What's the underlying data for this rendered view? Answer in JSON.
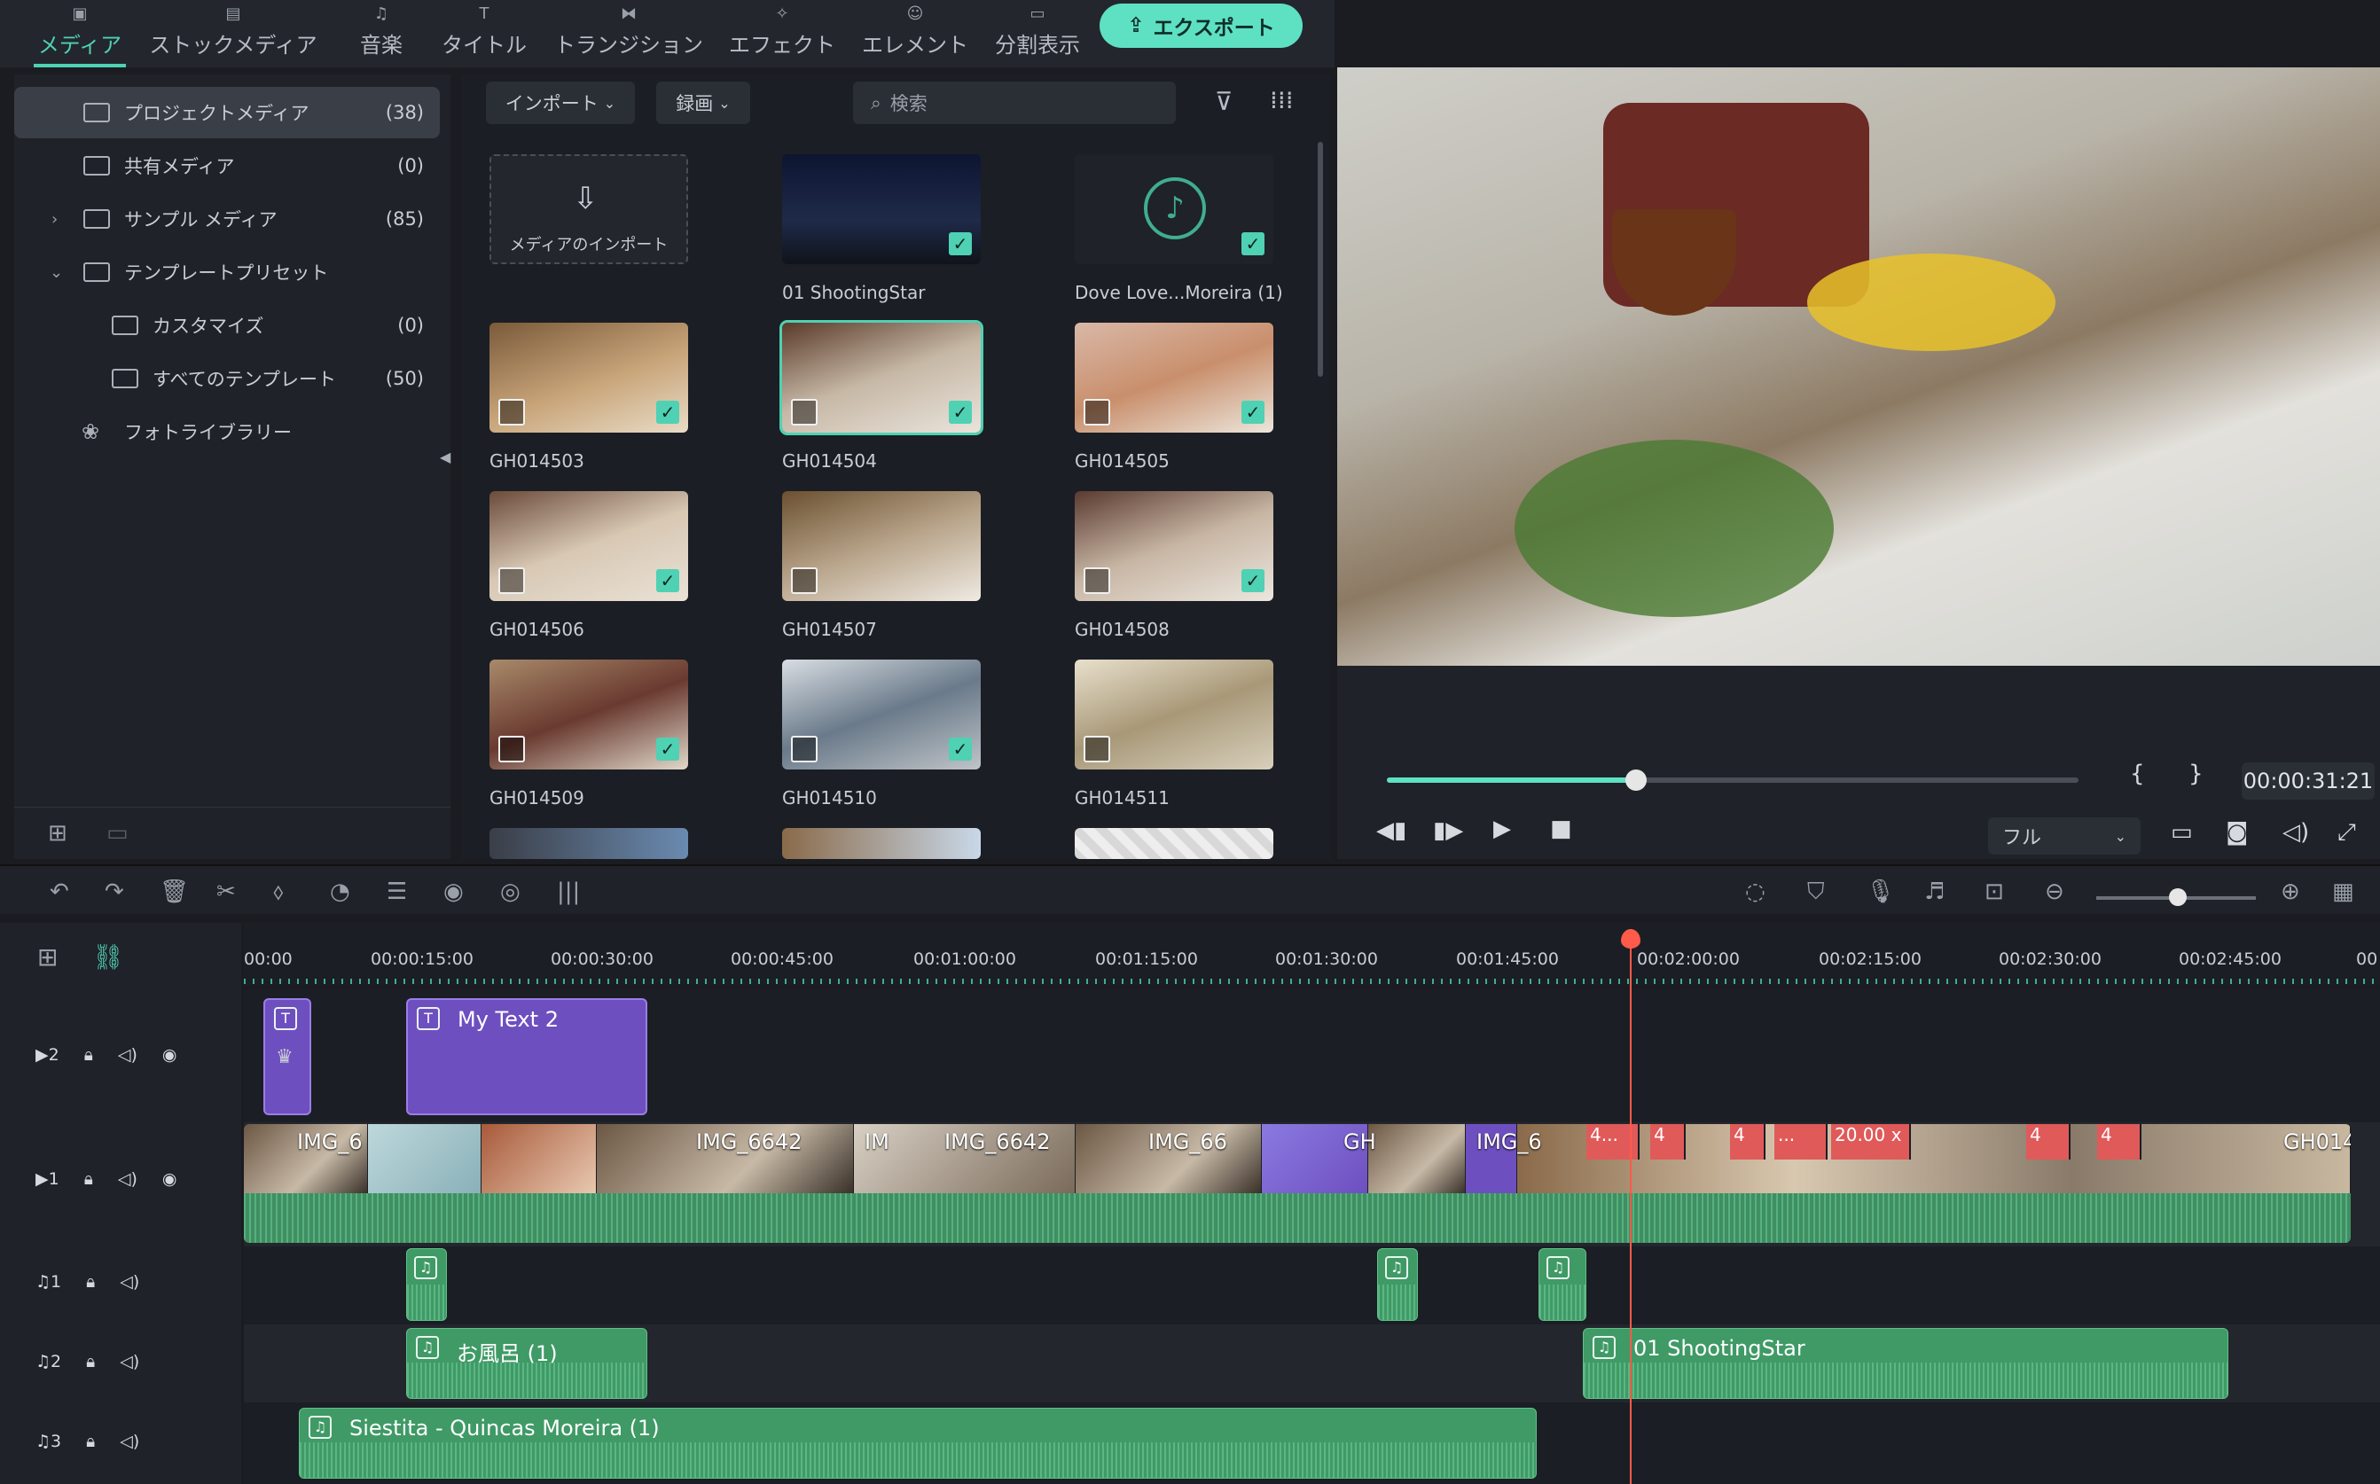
{
  "nav": {
    "tabs": [
      {
        "label": "メディア",
        "icon": "media-icon",
        "active": true
      },
      {
        "label": "ストックメディア",
        "icon": "stock-icon"
      },
      {
        "label": "音楽",
        "icon": "music-icon"
      },
      {
        "label": "タイトル",
        "icon": "title-icon"
      },
      {
        "label": "トランジション",
        "icon": "transition-icon"
      },
      {
        "label": "エフェクト",
        "icon": "effect-icon"
      },
      {
        "label": "エレメント",
        "icon": "element-icon"
      },
      {
        "label": "分割表示",
        "icon": "split-icon"
      }
    ],
    "export_label": "エクスポート"
  },
  "library": {
    "items": [
      {
        "label": "プロジェクトメディア",
        "count": "(38)"
      },
      {
        "label": "共有メディア",
        "count": "(0)"
      },
      {
        "label": "サンプル メディア",
        "count": "(85)"
      },
      {
        "label": "テンプレートプリセット",
        "count": ""
      },
      {
        "label": "カスタマイズ",
        "count": "(0)"
      },
      {
        "label": "すべてのテンプレート",
        "count": "(50)"
      },
      {
        "label": "フォトライブラリー",
        "count": ""
      }
    ]
  },
  "media": {
    "import_label": "インポート",
    "record_label": "録画",
    "search_placeholder": "検索",
    "import_tile_label": "メディアのインポート",
    "items": [
      {
        "name": "01 ShootingStar"
      },
      {
        "name": "Dove Love...Moreira (1)"
      },
      {
        "name": "GH014503"
      },
      {
        "name": "GH014504"
      },
      {
        "name": "GH014505"
      },
      {
        "name": "GH014506"
      },
      {
        "name": "GH014507"
      },
      {
        "name": "GH014508"
      },
      {
        "name": "GH014509"
      },
      {
        "name": "GH014510"
      },
      {
        "name": "GH014511"
      }
    ]
  },
  "player": {
    "timecode": "00:00:31:21",
    "quality": "フル",
    "progress": 0.36
  },
  "ruler": {
    "ticks": [
      "00:00",
      "00:00:15:00",
      "00:00:30:00",
      "00:00:45:00",
      "00:01:00:00",
      "00:01:15:00",
      "00:01:30:00",
      "00:01:45:00",
      "00:02:00:00",
      "00:02:15:00",
      "00:02:30:00",
      "00:02:45:00",
      "00"
    ]
  },
  "tracks": {
    "video2": {
      "num": "2",
      "title_clip": "My Text 2"
    },
    "video1": {
      "num": "1",
      "labels": [
        "IMG_6",
        "IMG_6642",
        "IM",
        "IMG_6642",
        "IMG_66",
        "GH",
        "IMG_6",
        "GH014"
      ],
      "speed": "20.00 x",
      "red": [
        "4...",
        "4",
        "4",
        "...",
        "4",
        "4"
      ]
    },
    "audio1": {
      "num": "1"
    },
    "audio2": {
      "num": "2",
      "clip1": "お風呂 (1)",
      "clip2": "01 ShootingStar"
    },
    "audio3": {
      "num": "3",
      "clip": "Siestita - Quincas Moreira (1)"
    }
  }
}
